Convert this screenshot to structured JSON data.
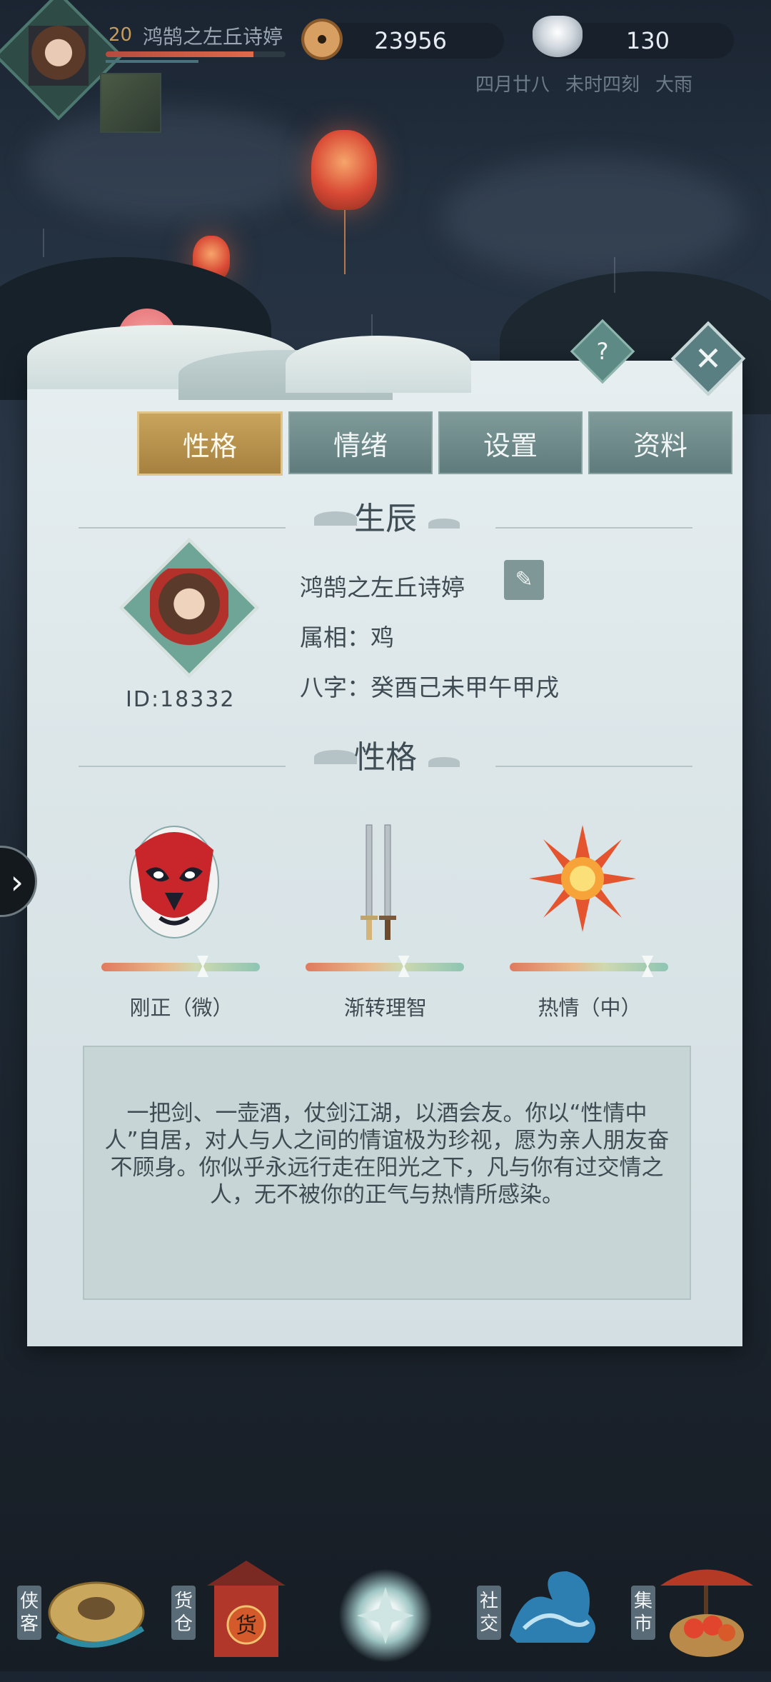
{
  "hud": {
    "level": "20",
    "player_name": "鸿鹄之左丘诗婷",
    "hp_fraction": 0.82,
    "copper": "23956",
    "silver": "130",
    "date": "四月廿八",
    "time": "未时四刻",
    "weather": "大雨"
  },
  "panel": {
    "help_label": "?",
    "close_label": "✕",
    "tabs": [
      {
        "label": "性格",
        "active": true
      },
      {
        "label": "情绪",
        "active": false
      },
      {
        "label": "设置",
        "active": false
      },
      {
        "label": "资料",
        "active": false
      }
    ],
    "birth_title": "生辰",
    "player_id": "ID:18332",
    "name": "鸿鹄之左丘诗婷",
    "edit_icon": "pencil-icon",
    "zodiac": "属相：鸡",
    "bazi": "八字：癸酉己未甲午甲戌",
    "personality_title": "性格",
    "traits": [
      {
        "label": "刚正（微）",
        "icon": "opera-mask-icon",
        "level": 0.64
      },
      {
        "label": "渐转理智",
        "icon": "twin-swords-icon",
        "level": 0.62
      },
      {
        "label": "热情（中）",
        "icon": "sun-flame-icon",
        "level": 0.87
      }
    ],
    "description": "一把剑、一壶酒，仗剑江湖，以酒会友。你以“性情中人”自居，对人与人之间的情谊极为珍视，愿为亲人朋友奋不顾身。你似乎永远行走在阳光之下，凡与你有过交情之人，无不被你的正气与热情所感染。"
  },
  "side_arrow": "›",
  "bottom_nav": [
    {
      "label": "侠客",
      "icon": "straw-hat-icon"
    },
    {
      "label": "货仓",
      "icon": "shop-gate-icon"
    },
    {
      "label": "",
      "icon": "compass-star-icon"
    },
    {
      "label": "社交",
      "icon": "wave-icon"
    },
    {
      "label": "集市",
      "icon": "market-stall-icon"
    }
  ],
  "colors": {
    "tab_active": "#b8924e",
    "tab_inactive": "#6e8a8b",
    "panel_bg": "#dfe8ea"
  }
}
